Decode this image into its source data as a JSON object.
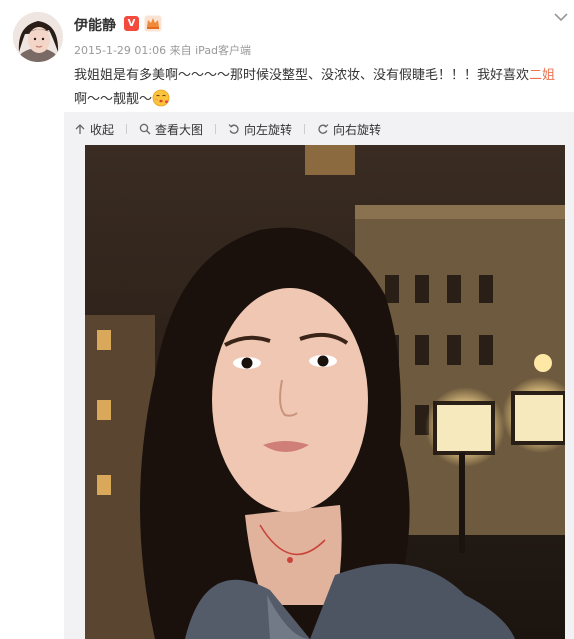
{
  "post": {
    "username": "伊能静",
    "verified_badge": "V",
    "timestamp": "2015-1-29 01:06",
    "source_prefix": "来自",
    "source_device": "iPad客户端",
    "text_part1": "我姐姐是有多美啊～～～～那时候没整型、没浓妆、没有假睫毛！！！我好喜欢",
    "text_link": "二姐",
    "text_part2": "啊～～靓靓～"
  },
  "media_toolbar": {
    "collapse_label": "收起",
    "view_large_label": "查看大图",
    "rotate_left_label": "向左旋转",
    "rotate_right_label": "向右旋转"
  },
  "icons": {
    "menu": "chevron-down-icon",
    "collapse": "arrow-up-icon",
    "view_large": "magnifier-icon",
    "rotate_left": "rotate-left-icon",
    "rotate_right": "rotate-right-icon",
    "emoji": "kiss-emoji-icon"
  },
  "colors": {
    "link": "#eb7350",
    "verified": "#f24b3e",
    "panel_bg": "#f2f2f5",
    "meta_text": "#999999"
  }
}
